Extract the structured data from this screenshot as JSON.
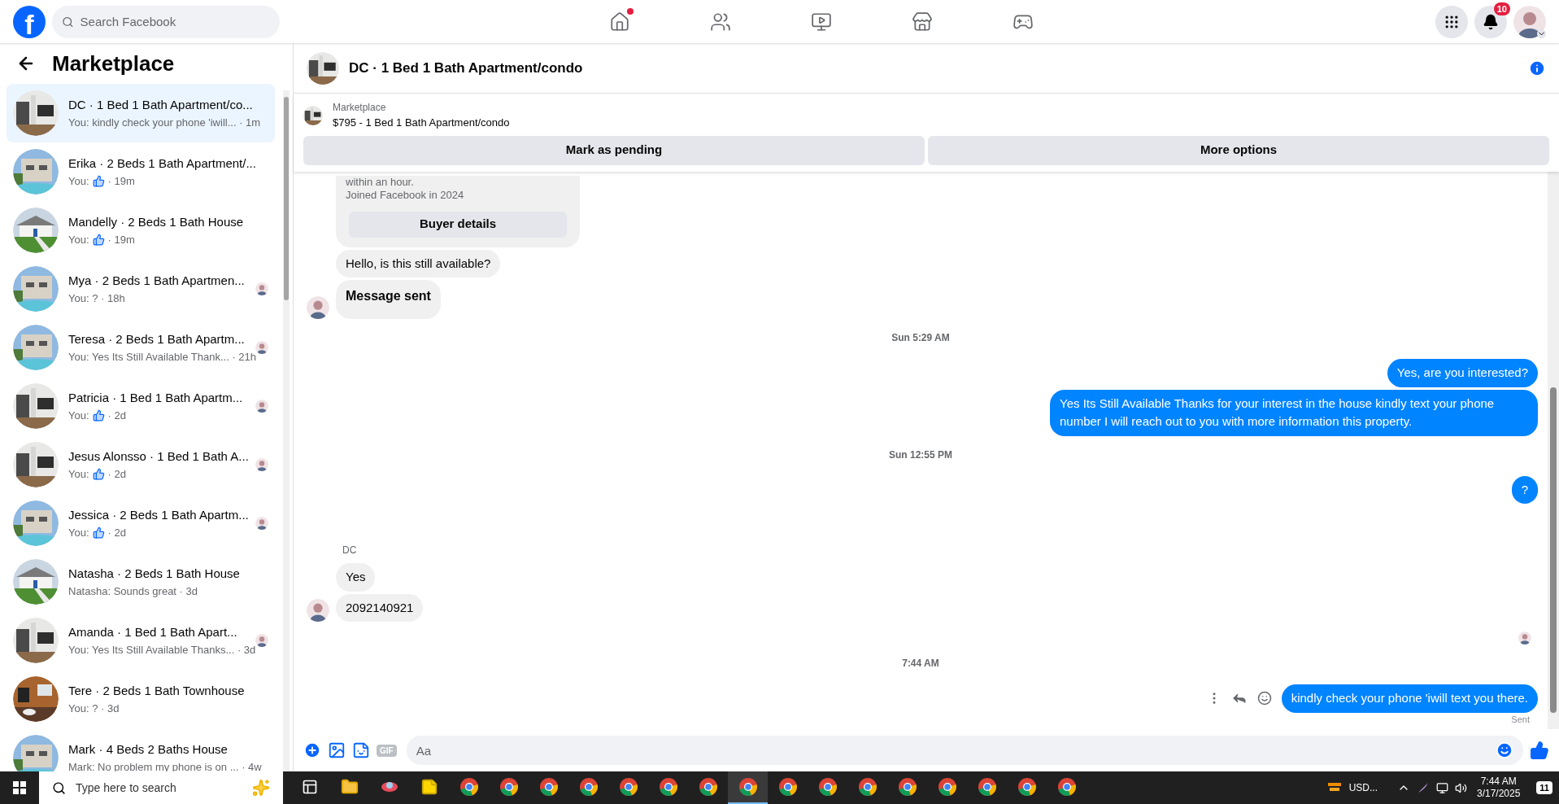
{
  "topbar": {
    "logo": "f",
    "search_placeholder": "Search Facebook",
    "nav": [
      {
        "kind": "home",
        "dot": true
      },
      {
        "kind": "friends",
        "dot": false
      },
      {
        "kind": "video",
        "dot": false
      },
      {
        "kind": "store",
        "dot": false
      },
      {
        "kind": "gaming",
        "dot": false
      }
    ],
    "notifications": "10"
  },
  "sidebar": {
    "title": "Marketplace",
    "conversations": [
      {
        "title": "DC · 1 Bed 1 Bath Apartment/co...",
        "preview": "You: kindly check your phone 'iwill...",
        "like": false,
        "time": " · 1m",
        "selected": true,
        "seen": false
      },
      {
        "title": "Erika · 2 Beds 1 Bath Apartment/...",
        "preview": "You:",
        "like": true,
        "time": "· 19m",
        "selected": false,
        "seen": false
      },
      {
        "title": "Mandelly · 2 Beds 1 Bath House",
        "preview": "You:",
        "like": true,
        "time": "· 19m",
        "selected": false,
        "seen": false
      },
      {
        "title": "Mya · 2 Beds 1 Bath Apartmen...",
        "preview": "You: ? · 18h",
        "like": false,
        "selected": false,
        "seen": true
      },
      {
        "title": "Teresa · 2 Beds 1 Bath Apartm...",
        "preview": "You: Yes Its Still Available Thank...",
        "like": false,
        "time": " · 21h",
        "selected": false,
        "seen": true
      },
      {
        "title": "Patricia · 1 Bed 1 Bath Apartm...",
        "preview": "You:",
        "like": true,
        "time": "· 2d",
        "selected": false,
        "seen": true
      },
      {
        "title": "Jesus Alonsso · 1 Bed 1 Bath A...",
        "preview": "You:",
        "like": true,
        "time": "· 2d",
        "selected": false,
        "seen": true
      },
      {
        "title": "Jessica · 2 Beds 1 Bath Apartm...",
        "preview": "You:",
        "like": true,
        "time": "· 2d",
        "selected": false,
        "seen": true
      },
      {
        "title": "Natasha · 2 Beds 1 Bath House",
        "preview": "Natasha: Sounds great · 3d",
        "like": false,
        "selected": false,
        "seen": false
      },
      {
        "title": "Amanda · 1 Bed 1 Bath Apart...",
        "preview": "You: Yes Its Still Available Thanks...",
        "like": false,
        "time": " · 3d",
        "selected": false,
        "seen": true
      },
      {
        "title": "Tere · 2 Beds 1 Bath Townhouse",
        "preview": "You: ? · 3d",
        "like": false,
        "selected": false,
        "seen": false
      },
      {
        "title": "Mark · 4 Beds 2 Baths House",
        "preview": "Mark: No problem my phone is on ...",
        "like": false,
        "time": " · 4w",
        "selected": false,
        "seen": false
      }
    ]
  },
  "chat": {
    "title": "DC · 1 Bed 1 Bath Apartment/condo",
    "listing": {
      "label": "Marketplace",
      "title": "$795 - 1 Bed 1 Bath Apartment/condo",
      "actions": [
        "Mark as pending",
        "More options"
      ]
    },
    "messages": [
      {
        "kind": "card",
        "lines": [
          "within an hour.",
          "Joined Facebook in 2024"
        ],
        "button": "Buyer details"
      },
      {
        "kind": "incoming",
        "text": "Hello, is this still available?",
        "avatar": false,
        "bold": false
      },
      {
        "kind": "incoming",
        "text": "Message sent",
        "avatar": true,
        "bold": true
      },
      {
        "kind": "time",
        "text": "Sun 5:29 AM"
      },
      {
        "kind": "outgoing",
        "text": "Yes, are you interested?",
        "actions": false
      },
      {
        "kind": "outgoing",
        "text": "Yes Its Still Available Thanks for your interest in the house kindly text your phone number I will reach out to you with more information this property.",
        "actions": false
      },
      {
        "kind": "time",
        "text": "Sun 12:55 PM"
      },
      {
        "kind": "outgoing",
        "text": "?",
        "actions": false
      },
      {
        "kind": "sender",
        "text": "DC"
      },
      {
        "kind": "incoming",
        "text": "Yes",
        "avatar": false,
        "bold": false
      },
      {
        "kind": "incoming",
        "text": "2092140921",
        "avatar": true,
        "bold": false
      },
      {
        "kind": "seen"
      },
      {
        "kind": "time",
        "text": "7:44 AM"
      },
      {
        "kind": "outgoing",
        "text": "kindly check your phone 'iwill text you there.",
        "actions": true
      },
      {
        "kind": "status",
        "text": "Sent"
      }
    ],
    "composer": {
      "gif": "GIF",
      "placeholder": "Aa"
    }
  },
  "taskbar": {
    "search_placeholder": "Type here to search",
    "apps": [
      {
        "kind": "taskview",
        "selected": false
      },
      {
        "kind": "folder",
        "selected": false
      },
      {
        "kind": "app",
        "selected": false
      },
      {
        "kind": "notes",
        "selected": false
      },
      {
        "kind": "browser",
        "selected": false
      },
      {
        "kind": "browser",
        "selected": false
      },
      {
        "kind": "browser",
        "selected": false
      },
      {
        "kind": "browser",
        "selected": false
      },
      {
        "kind": "browser",
        "selected": false
      },
      {
        "kind": "browser",
        "selected": false
      },
      {
        "kind": "browser",
        "selected": false
      },
      {
        "kind": "browser",
        "selected": true
      },
      {
        "kind": "browser",
        "selected": false
      },
      {
        "kind": "browser",
        "selected": false
      },
      {
        "kind": "browser",
        "selected": false
      },
      {
        "kind": "browser",
        "selected": false
      },
      {
        "kind": "browser",
        "selected": false
      },
      {
        "kind": "browser",
        "selected": false
      },
      {
        "kind": "browser",
        "selected": false
      },
      {
        "kind": "browser",
        "selected": false
      }
    ],
    "currency": "USD...",
    "time": "7:44 AM",
    "date": "3/17/2025",
    "notifications": "11"
  }
}
